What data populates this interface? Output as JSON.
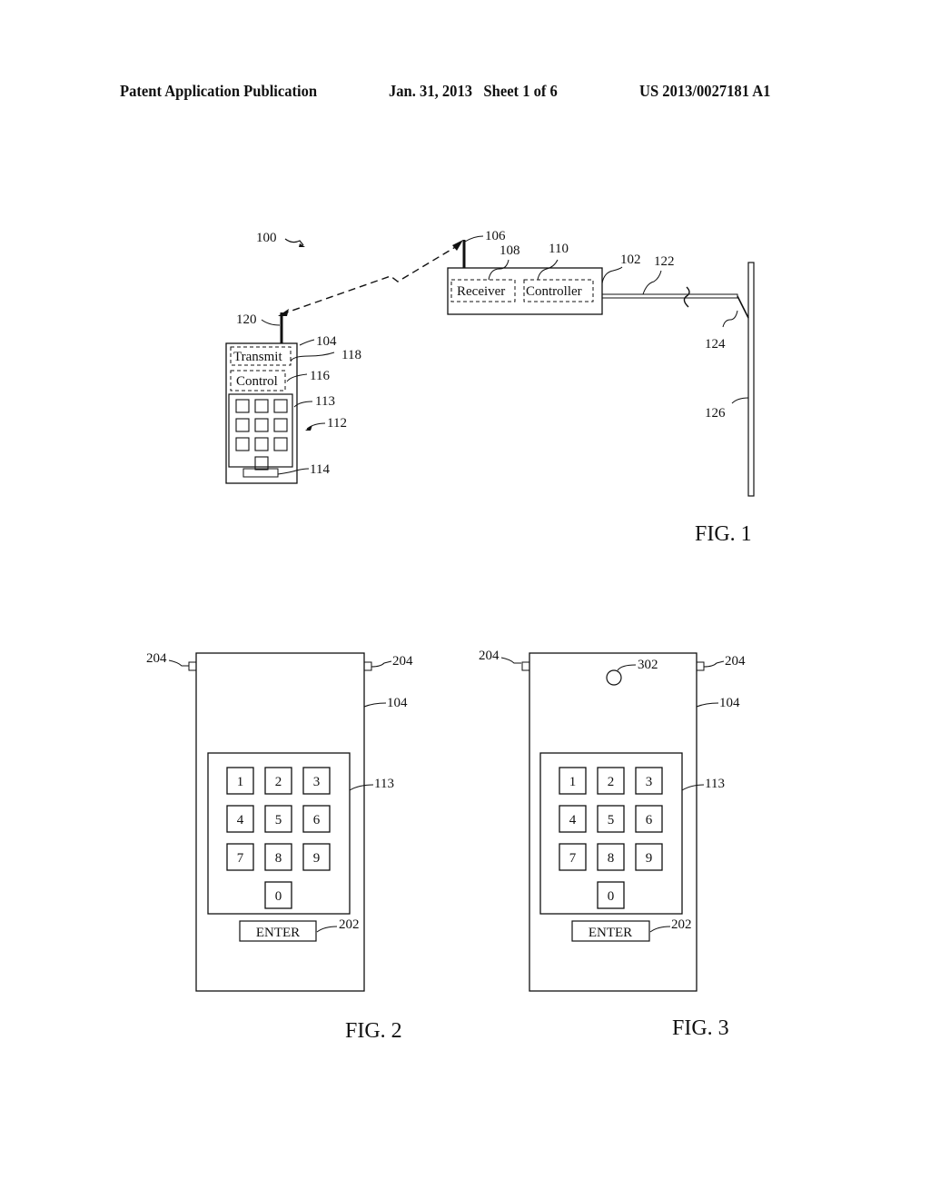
{
  "header": {
    "publication": "Patent Application Publication",
    "date_sheet": "Jan. 31, 2013   Sheet 1 of 6",
    "number": "US 2013/0027181 A1"
  },
  "fig1": {
    "caption": "FIG. 1",
    "refs": {
      "system": "100",
      "receiver_unit": "102",
      "transmitter": "104",
      "antenna_rx": "106",
      "receiver": "108",
      "controller": "110",
      "keypad_area": "112",
      "keypad": "113",
      "button": "114",
      "control": "116",
      "transmit": "118",
      "antenna_tx": "120",
      "cable": "122",
      "latch": "124",
      "door": "126"
    },
    "labels": {
      "transmit": "Transmit",
      "control": "Control",
      "receiver": "Receiver",
      "controller": "Controller"
    }
  },
  "fig2": {
    "caption": "FIG. 2",
    "refs": {
      "side_button": "204",
      "device": "104",
      "keypad": "113",
      "enter": "202"
    },
    "keys": [
      "1",
      "2",
      "3",
      "4",
      "5",
      "6",
      "7",
      "8",
      "9",
      "0"
    ],
    "enter_label": "ENTER"
  },
  "fig3": {
    "caption": "FIG. 3",
    "refs": {
      "side_button": "204",
      "device": "104",
      "keypad": "113",
      "enter": "202",
      "indicator": "302"
    },
    "keys": [
      "1",
      "2",
      "3",
      "4",
      "5",
      "6",
      "7",
      "8",
      "9",
      "0"
    ],
    "enter_label": "ENTER"
  }
}
